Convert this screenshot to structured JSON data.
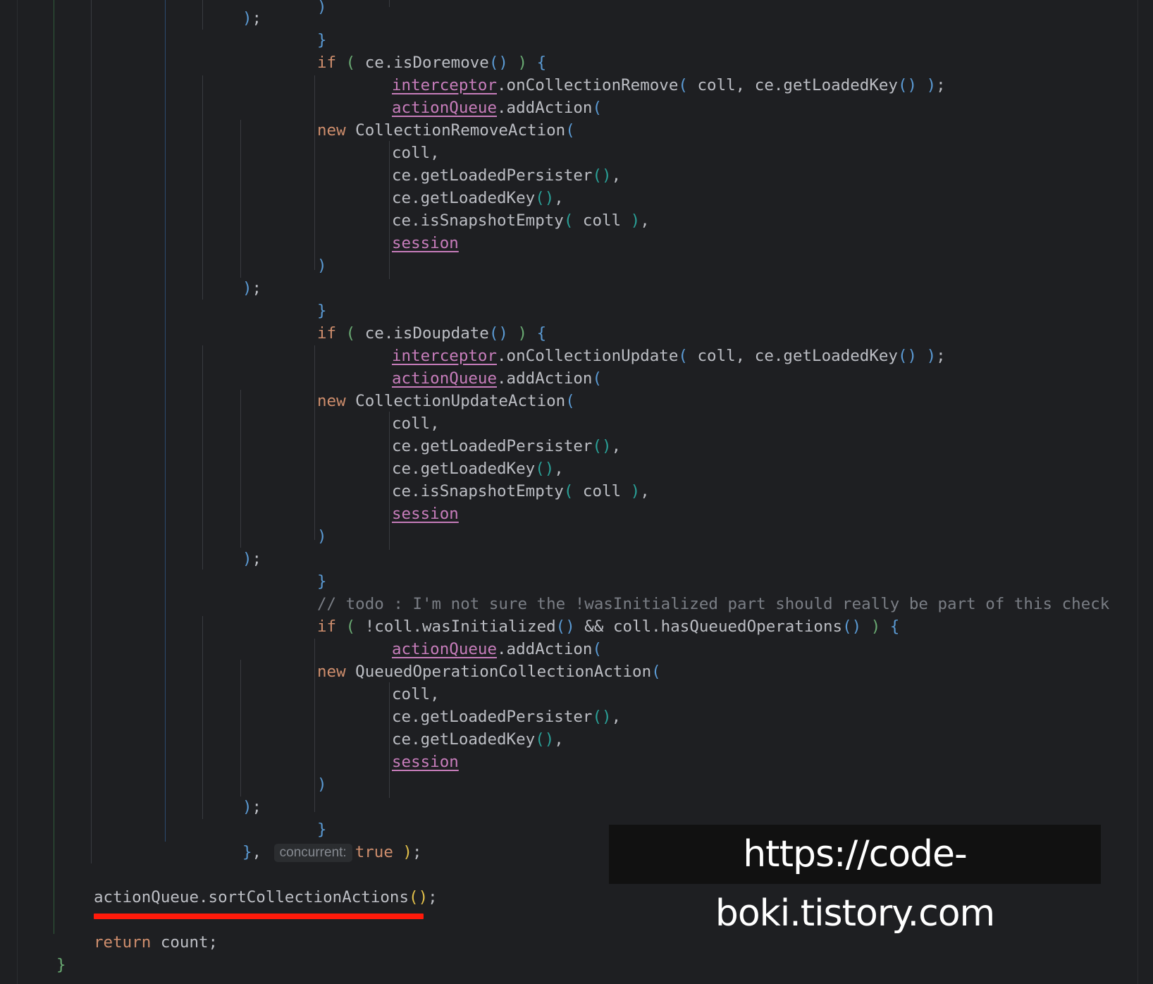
{
  "editor": {
    "language": "Java",
    "theme_colors": {
      "background": "#1e1f22",
      "text": "#bcbec4",
      "keyword": "#cf8e6d",
      "field": "#c77dbb",
      "comment": "#7a7e85",
      "highlight_underline": "#ff1a0a"
    }
  },
  "code": {
    "l0": "",
    "l1": ");",
    "l2": "}",
    "l3_if": "if",
    "l3_call": "ce.isDoremove",
    "l4_field": "interceptor",
    "l4_rest": ".onCollectionRemove",
    "l4_args": " coll, ce.getLoadedKey",
    "l5_field": "actionQueue",
    "l5_rest": ".addAction",
    "l6_new": "new",
    "l6_cls": " CollectionRemoveAction",
    "arg_coll": "coll,",
    "arg_persister": "ce.getLoadedPersister",
    "arg_key": "ce.getLoadedKey",
    "arg_snapshot": "ce.isSnapshotEmpty",
    "arg_snapshot_in": " coll ",
    "arg_session": "session",
    "l15_call": "ce.isDoupdate",
    "l16_rest": ".onCollectionUpdate",
    "l18_cls": " CollectionUpdateAction",
    "comment": "// todo : I'm not sure the !wasInitialized part should really be part of this check",
    "l27_a": " !coll.wasInitialized",
    "l27_b": " && coll.hasQueuedOperations",
    "l29_cls": " QueuedOperationCollectionAction",
    "hint": "concurrent:",
    "kw_true": "true",
    "sort_stmt": "actionQueue.sortCollectionActions",
    "kw_return": "return",
    "return_rest": " count;"
  },
  "watermark": {
    "text": "https://code-boki.tistory.com"
  }
}
